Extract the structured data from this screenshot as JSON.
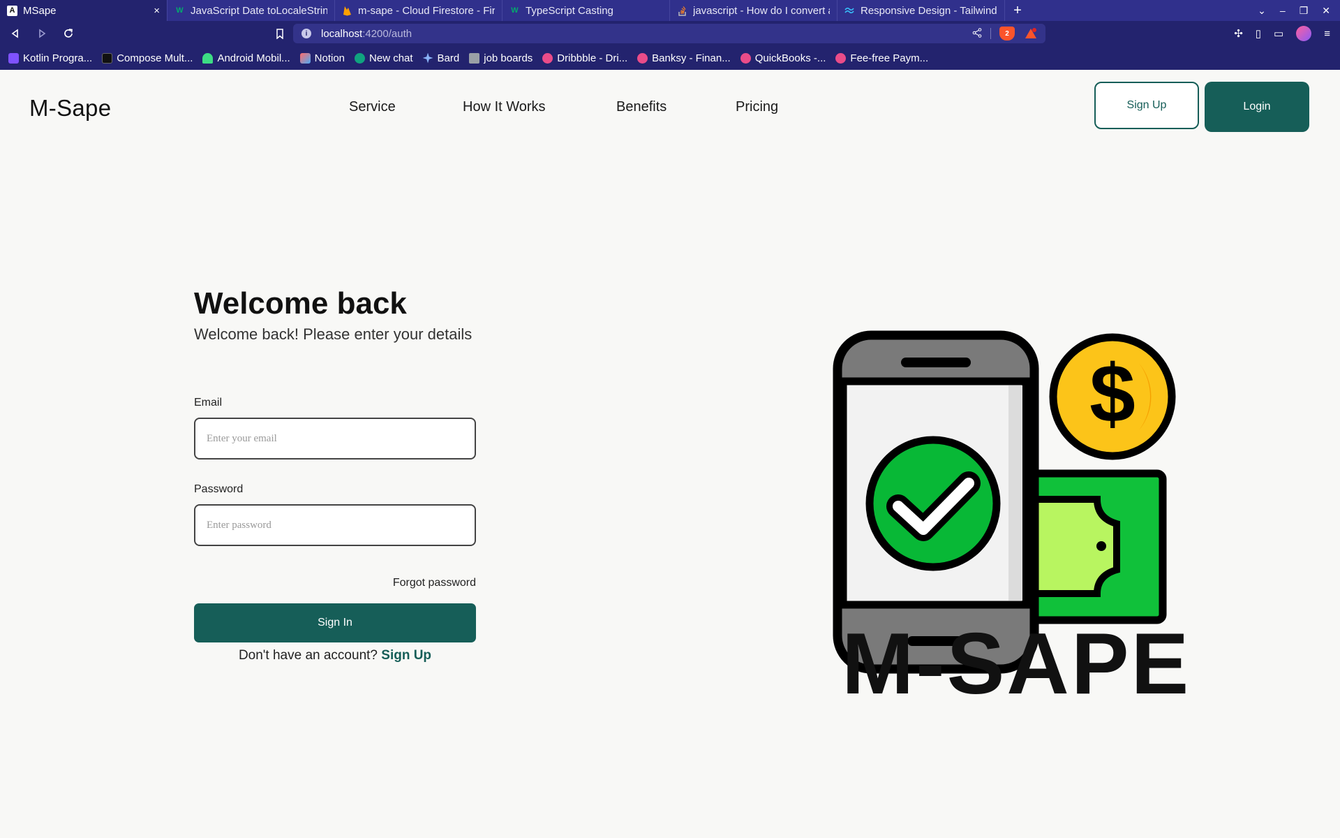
{
  "browser": {
    "tabs": [
      {
        "title": "MSape",
        "icon": "angular-icon",
        "active": true
      },
      {
        "title": "JavaScript Date toLocaleStrin",
        "icon": "w3-icon"
      },
      {
        "title": "m-sape - Cloud Firestore - Fire",
        "icon": "firebase-icon"
      },
      {
        "title": "TypeScript Casting",
        "icon": "w3-icon"
      },
      {
        "title": "javascript - How do I convert a",
        "icon": "stackoverflow-icon"
      },
      {
        "title": "Responsive Design - Tailwind",
        "icon": "tailwind-icon"
      }
    ],
    "close_glyph": "×",
    "new_tab_glyph": "+",
    "url_host": "localhost",
    "url_path": ":4200/auth",
    "shield_count": "2",
    "bookmarks": [
      {
        "label": "Kotlin Progra...",
        "color": "#7f52ff"
      },
      {
        "label": "Compose Mult...",
        "color": "#111111"
      },
      {
        "label": "Android Mobil...",
        "color": "#3ddc84"
      },
      {
        "label": "Notion",
        "color": "#ffffff"
      },
      {
        "label": "New chat",
        "color": "#10a37f"
      },
      {
        "label": "Bard",
        "color": "#8ab4f8"
      },
      {
        "label": "job boards",
        "color": "#9aa0a6"
      },
      {
        "label": "Dribbble - Dri...",
        "color": "#ea4c89"
      },
      {
        "label": "Banksy - Finan...",
        "color": "#ea4c89"
      },
      {
        "label": "QuickBooks -...",
        "color": "#ea4c89"
      },
      {
        "label": "Fee-free Paym...",
        "color": "#ea4c89"
      }
    ]
  },
  "header": {
    "brand": "M-Sape",
    "nav": [
      "Service",
      "How It Works",
      "Benefits",
      "Pricing"
    ],
    "signup_label": "Sign Up",
    "login_label": "Login"
  },
  "form": {
    "title": "Welcome back",
    "subtitle": "Welcome back! Please enter your details",
    "email_label": "Email",
    "email_placeholder": "Enter your email",
    "email_value": "",
    "password_label": "Password",
    "password_placeholder": "Enter password",
    "password_value": "",
    "forgot": "Forgot password",
    "submit": "Sign In",
    "no_account": "Don't have an account?",
    "signup_link": "Sign Up"
  },
  "illustration": {
    "wordmark": "M-SAPE",
    "dollar_glyph": "$"
  },
  "colors": {
    "brand_teal": "#165e58",
    "tabbar": "#30308c",
    "toolbar": "#23236e",
    "page_bg": "#f8f8f6",
    "coin": "#fcc419",
    "check": "#08b836",
    "bill": "#10c13a"
  }
}
